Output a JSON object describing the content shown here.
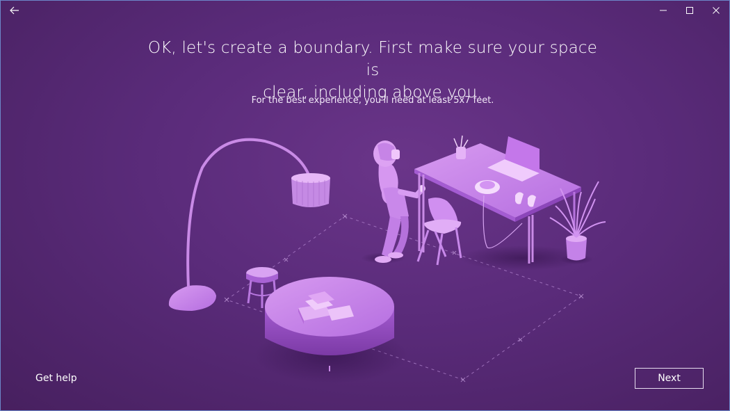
{
  "titlebar": {
    "back_icon": "back-arrow-icon",
    "minimize_icon": "minimize-icon",
    "maximize_icon": "maximize-icon",
    "close_icon": "close-icon"
  },
  "content": {
    "heading_line1": "OK, let's create a boundary. First make sure your space is",
    "heading_line2": "clear, including above you.",
    "subheading": "For the best experience, you'll need at least 5x7 feet."
  },
  "footer": {
    "get_help_label": "Get help",
    "next_label": "Next"
  },
  "colors": {
    "background": "#5a2b7a",
    "illustration_light": "#c98ae6",
    "illustration_mid": "#a55fd0",
    "illustration_dark": "#7a3a9e",
    "button_border": "#e8dff0"
  }
}
